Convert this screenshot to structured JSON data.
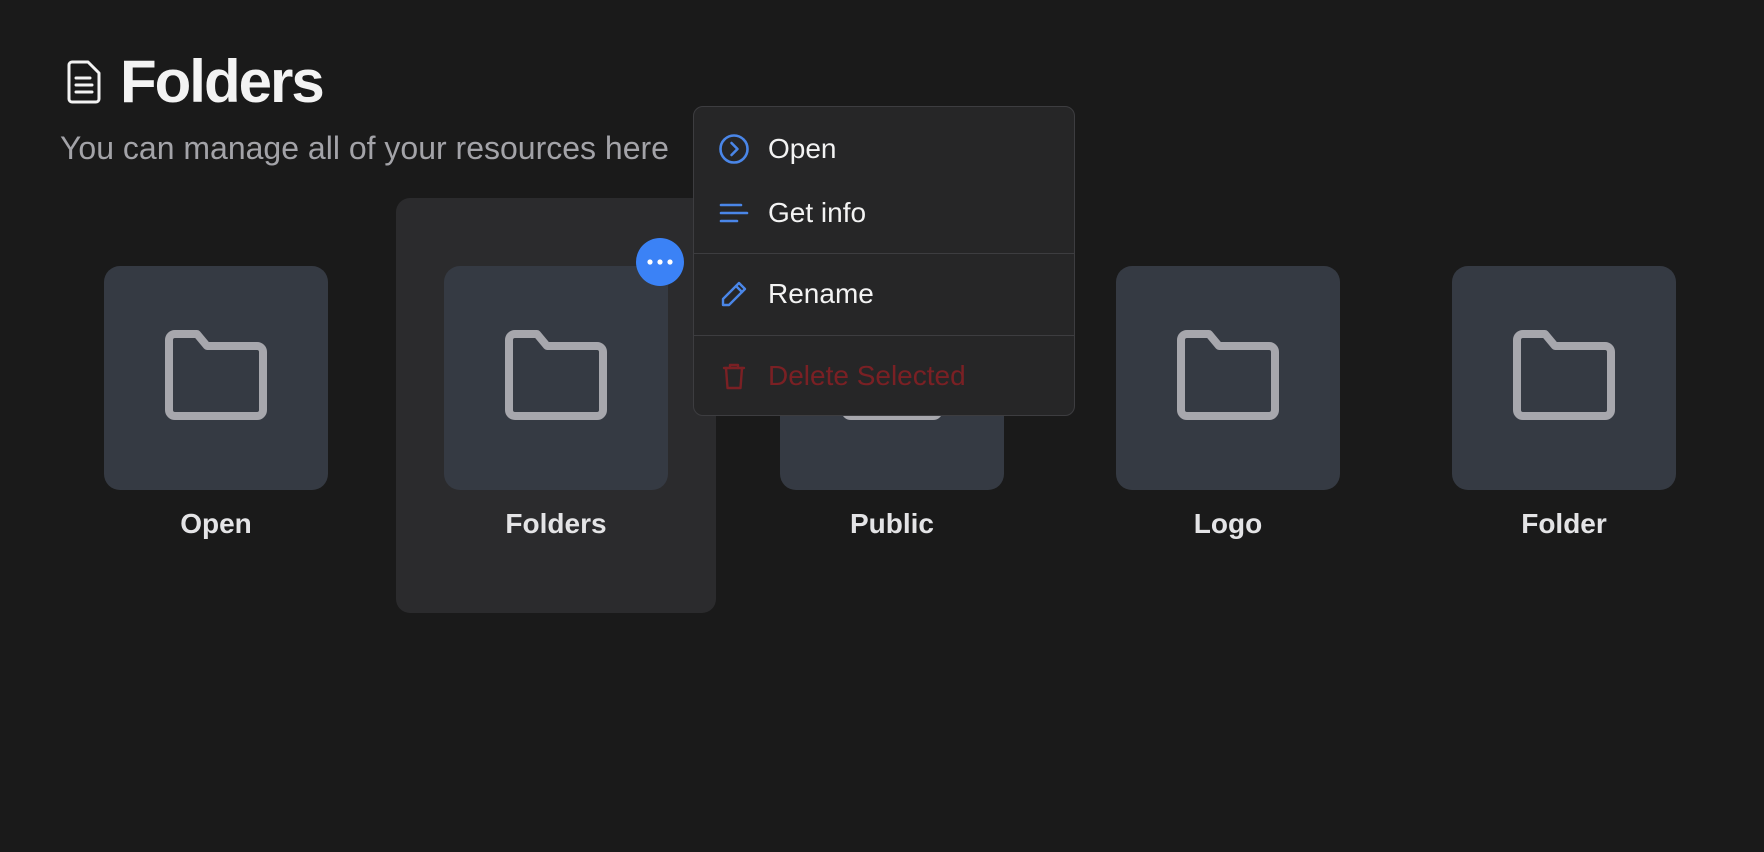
{
  "header": {
    "title": "Folders",
    "subtitle": "You can manage all of your resources here",
    "icon": "document-icon"
  },
  "folders": [
    {
      "name": "Open",
      "icon": "folder-icon",
      "selected": false
    },
    {
      "name": "Folders",
      "icon": "folder-icon",
      "selected": true
    },
    {
      "name": "Public",
      "icon": "folder-icon",
      "selected": false
    },
    {
      "name": "Logo",
      "icon": "folder-icon",
      "selected": false
    },
    {
      "name": "Folder",
      "icon": "folder-icon",
      "selected": false
    }
  ],
  "context_menu": {
    "items": [
      {
        "label": "Open",
        "icon": "chevron-right-circle-icon"
      },
      {
        "label": "Get info",
        "icon": "lines-icon"
      },
      {
        "label": "Rename",
        "icon": "pencil-icon"
      },
      {
        "label": "Delete Selected",
        "icon": "trash-icon",
        "danger": true
      }
    ]
  },
  "colors": {
    "background": "#1a1a1a",
    "accent": "#3b82f6",
    "danger": "#7a2024",
    "tile_thumb": "#353a43",
    "tile_selected": "#2b2b2d"
  }
}
